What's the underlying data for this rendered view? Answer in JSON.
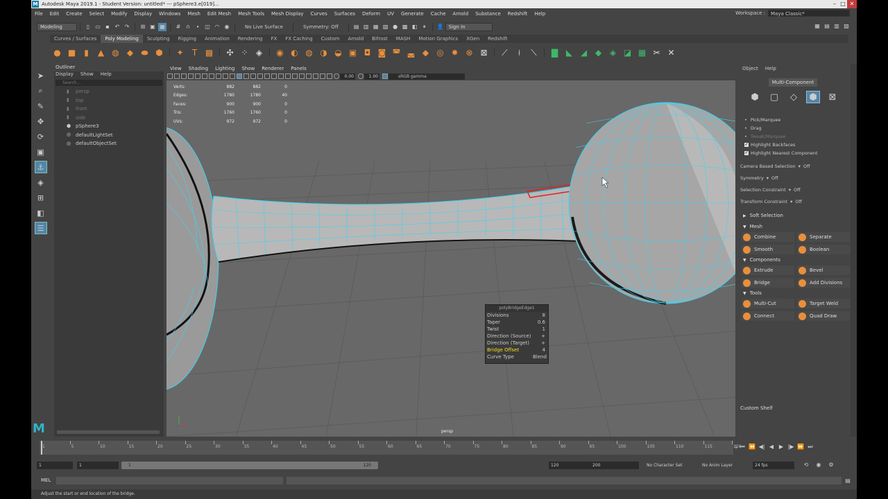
{
  "window": {
    "title": "Autodesk Maya 2019.1 - Student Version: untitled*  ---  pSphere3.e[019]..."
  },
  "menus": [
    "File",
    "Edit",
    "Create",
    "Select",
    "Modify",
    "Display",
    "Windows",
    "Mesh",
    "Edit Mesh",
    "Mesh Tools",
    "Mesh Display",
    "Curves",
    "Surfaces",
    "Deform",
    "UV",
    "Generate",
    "Cache",
    "Arnold",
    "Substance",
    "Redshift",
    "Help"
  ],
  "workspace": {
    "label": "Workspace :",
    "value": "Maya Classic*"
  },
  "statusline": {
    "menuset": "Modeling",
    "live_surface": "No Live Surface",
    "symmetry": "Symmetry: Off",
    "sign_in": "Sign In"
  },
  "shelf_tabs": [
    {
      "label": "Curves / Surfaces",
      "active": false
    },
    {
      "label": "Poly Modeling",
      "active": true
    },
    {
      "label": "Sculpting",
      "active": false
    },
    {
      "label": "Rigging",
      "active": false
    },
    {
      "label": "Animation",
      "active": false
    },
    {
      "label": "Rendering",
      "active": false
    },
    {
      "label": "FX",
      "active": false
    },
    {
      "label": "FX Caching",
      "active": false
    },
    {
      "label": "Custom",
      "active": false
    },
    {
      "label": "Arnold",
      "active": false
    },
    {
      "label": "Bifrost",
      "active": false
    },
    {
      "label": "MASH",
      "active": false
    },
    {
      "label": "Motion Graphics",
      "active": false
    },
    {
      "label": "XGen",
      "active": false
    },
    {
      "label": "Redshift",
      "active": false
    }
  ],
  "outliner": {
    "title": "Outliner",
    "menu": [
      "Display",
      "Show",
      "Help"
    ],
    "search_placeholder": "Search...",
    "items": [
      {
        "label": "persp",
        "dim": true,
        "icon": "camera-icon"
      },
      {
        "label": "top",
        "dim": true,
        "icon": "camera-icon"
      },
      {
        "label": "front",
        "dim": true,
        "icon": "camera-icon"
      },
      {
        "label": "side",
        "dim": true,
        "icon": "camera-icon"
      },
      {
        "label": "pSphere3",
        "dim": false,
        "icon": "mesh-icon"
      },
      {
        "label": "defaultLightSet",
        "dim": false,
        "icon": "set-icon"
      },
      {
        "label": "defaultObjectSet",
        "dim": false,
        "icon": "set-icon"
      }
    ]
  },
  "viewport": {
    "menu": [
      "View",
      "Shading",
      "Lighting",
      "Show",
      "Renderer",
      "Panels"
    ],
    "exposure": "0.00",
    "gamma_value": "1.00",
    "color_space": "sRGB gamma",
    "camera_label": "persp",
    "hud": [
      {
        "label": "Verts:",
        "v1": "882",
        "v2": "882",
        "v3": "0"
      },
      {
        "label": "Edges:",
        "v1": "1780",
        "v2": "1780",
        "v3": "40"
      },
      {
        "label": "Faces:",
        "v1": "900",
        "v2": "900",
        "v3": "0"
      },
      {
        "label": "Tris:",
        "v1": "1760",
        "v2": "1760",
        "v3": "0"
      },
      {
        "label": "UVs:",
        "v1": "972",
        "v2": "972",
        "v3": "0"
      }
    ]
  },
  "bridge_popup": {
    "title": "polyBridgeEdge1",
    "rows": [
      {
        "label": "Divisions",
        "value": "8",
        "highlight": false
      },
      {
        "label": "Taper",
        "value": "0.6",
        "highlight": false
      },
      {
        "label": "Twist",
        "value": "1",
        "highlight": false
      },
      {
        "label": "Direction (Source)",
        "value": "+",
        "highlight": false
      },
      {
        "label": "Direction (Target)",
        "value": "+",
        "highlight": false
      },
      {
        "label": "Bridge Offset",
        "value": "4",
        "highlight": true
      },
      {
        "label": "Curve Type",
        "value": "Blend",
        "highlight": false
      }
    ]
  },
  "toolkit": {
    "menu": [
      "Object",
      "Help"
    ],
    "mode_button": "Multi-Component",
    "selection_options": [
      {
        "label": "Pick/Marquee",
        "type": "radio",
        "dim": false
      },
      {
        "label": "Drag",
        "type": "radio",
        "dim": false
      },
      {
        "label": "Tweak/Marquee",
        "type": "radio",
        "dim": true
      },
      {
        "label": "Highlight Backfaces",
        "type": "check",
        "dim": false
      },
      {
        "label": "Highlight Nearest Component",
        "type": "check",
        "dim": false
      }
    ],
    "settings": [
      {
        "label": "Camera Based Selection",
        "value": "Off"
      },
      {
        "label": "Symmetry",
        "value": "Off"
      },
      {
        "label": "Selection Constraint",
        "value": "Off"
      },
      {
        "label": "Transform Constraint",
        "value": "Off"
      }
    ],
    "soft_selection": "Soft Selection",
    "sections": [
      {
        "title": "Mesh",
        "buttons": [
          "Combine",
          "Separate",
          "Smooth",
          "Boolean"
        ]
      },
      {
        "title": "Components",
        "buttons": [
          "Extrude",
          "Bevel",
          "Bridge",
          "Add Divisions"
        ]
      },
      {
        "title": "Tools",
        "buttons": [
          "Multi-Cut",
          "Target Weld",
          "Connect",
          "Quad Draw"
        ]
      }
    ],
    "custom_shelf": "Custom Shelf"
  },
  "timeline": {
    "ticks": [
      "1",
      "5",
      "10",
      "15",
      "20",
      "25",
      "30",
      "35",
      "40",
      "45",
      "50",
      "55",
      "60",
      "65",
      "70",
      "75",
      "80",
      "85",
      "90",
      "95",
      "100",
      "105",
      "110",
      "115",
      "120"
    ],
    "current_frame": "1"
  },
  "range": {
    "start": "1",
    "start_inner": "1",
    "handle_start": "1",
    "handle_end": "120",
    "end_inner": "120",
    "end": "200",
    "character_set": "No Character Set",
    "anim_layer": "No Anim Layer",
    "fps": "24 fps"
  },
  "commandline": {
    "label": "MEL"
  },
  "helpline": {
    "text": "Adjust the start or end location of the bridge."
  }
}
